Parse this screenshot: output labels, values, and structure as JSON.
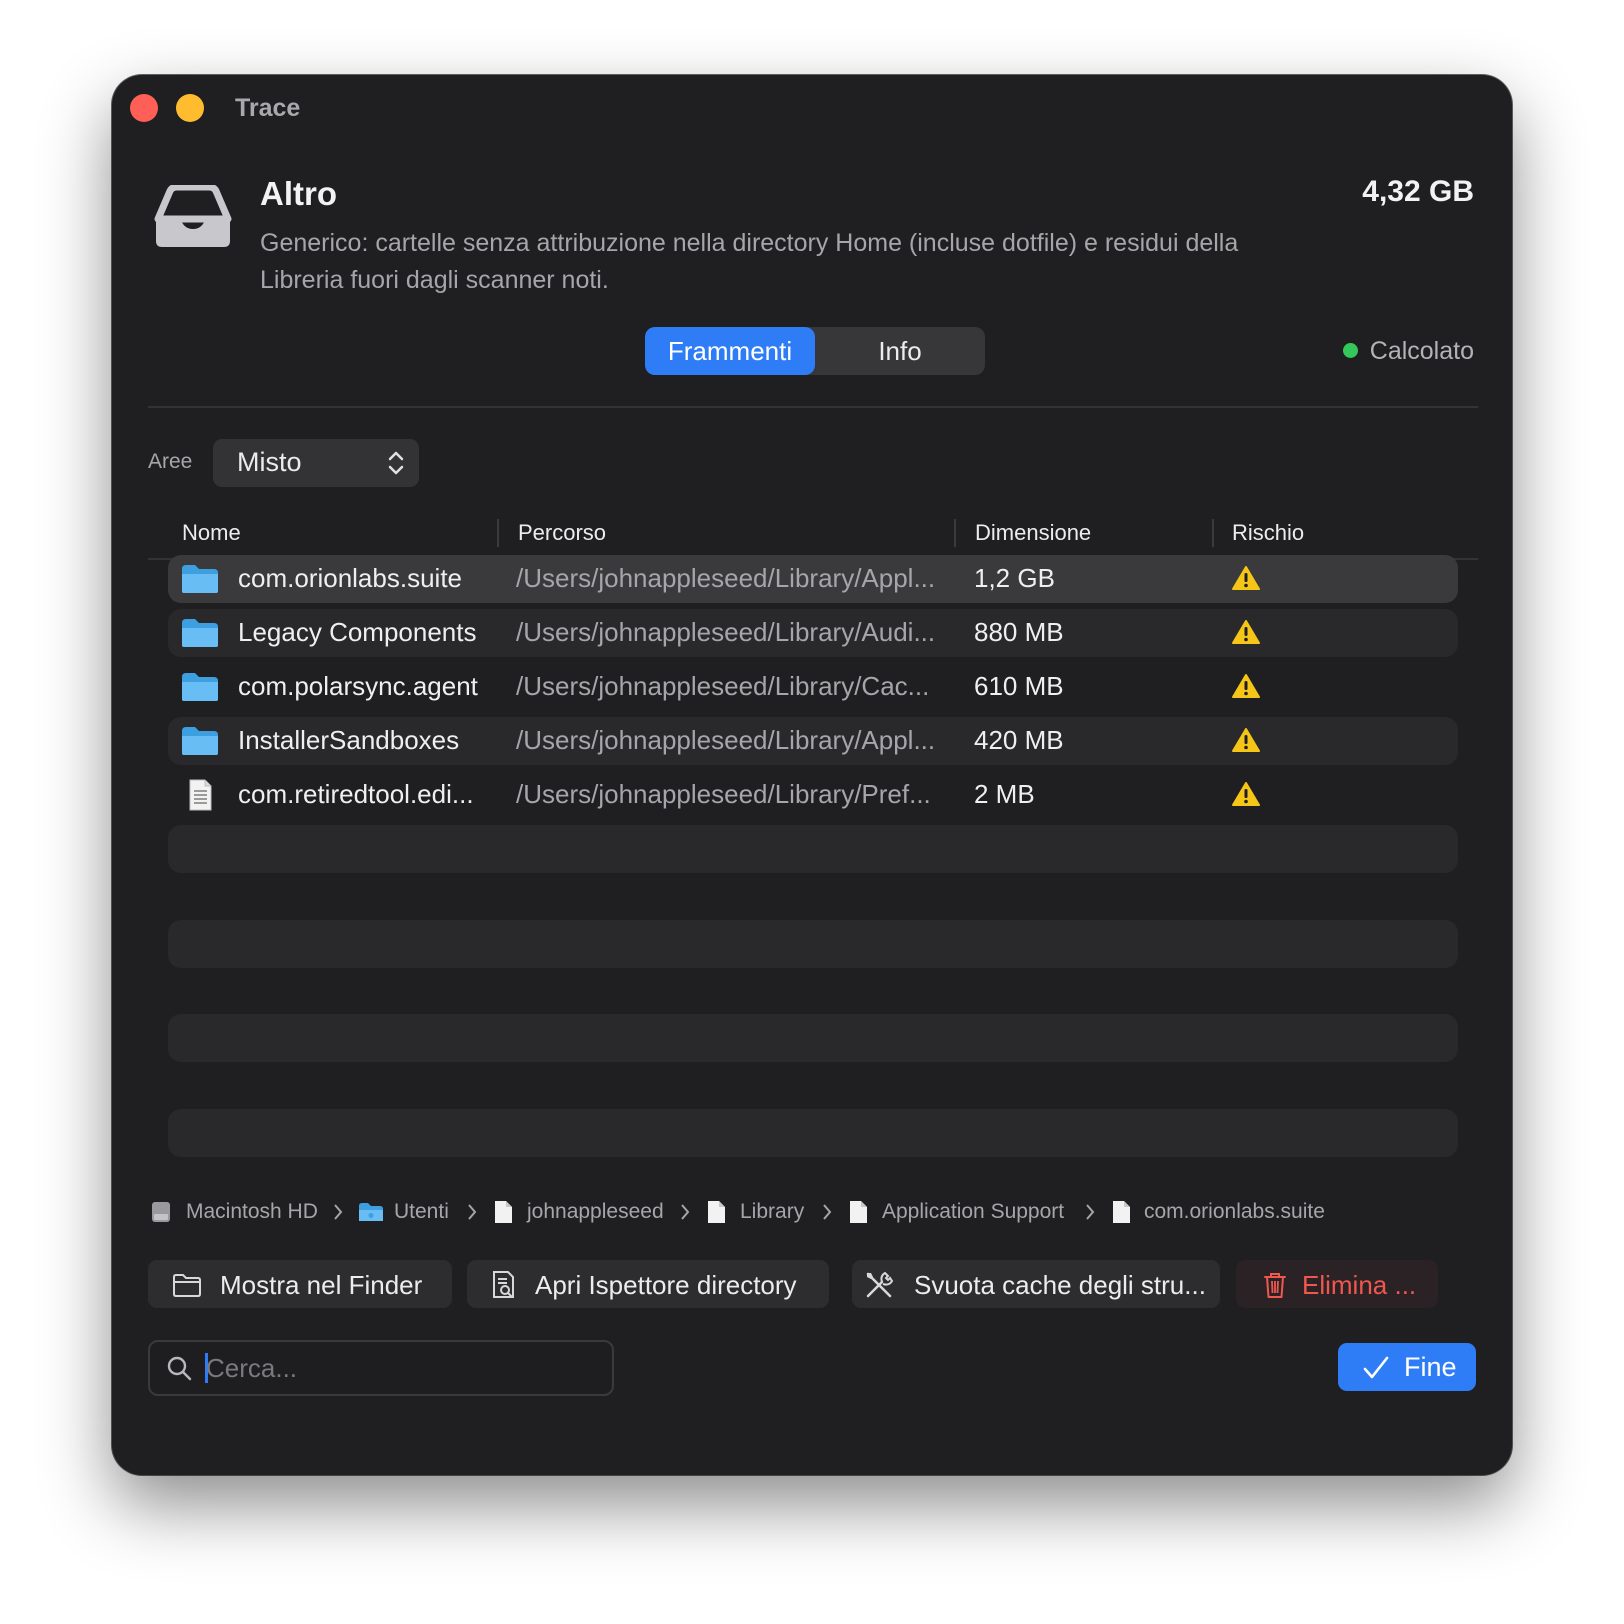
{
  "window": {
    "title": "Trace"
  },
  "category": {
    "icon": "tray-icon",
    "title": "Altro",
    "description": "Generico: cartelle senza attribuzione nella directory Home (incluse dotfile) e residui della Libreria fuori dagli scanner noti.",
    "total_size": "4,32 GB"
  },
  "tabs": [
    {
      "label": "Frammenti",
      "active": true
    },
    {
      "label": "Info",
      "active": false
    }
  ],
  "status": {
    "label": "Calcolato",
    "color": "#34c759"
  },
  "filter": {
    "label": "Aree",
    "value": "Misto"
  },
  "table": {
    "columns": [
      "Nome",
      "Percorso",
      "Dimensione",
      "Rischio"
    ],
    "rows": [
      {
        "icon": "folder-icon",
        "name": "com.orionlabs.suite",
        "path": "/Users/johnappleseed/Library/Appl...",
        "size": "1,2 GB",
        "risk": "warning-icon"
      },
      {
        "icon": "folder-icon",
        "name": "Legacy Components",
        "path": "/Users/johnappleseed/Library/Audi...",
        "size": "880 MB",
        "risk": "warning-icon"
      },
      {
        "icon": "folder-icon",
        "name": "com.polarsync.agent",
        "path": "/Users/johnappleseed/Library/Cac...",
        "size": "610 MB",
        "risk": "warning-icon"
      },
      {
        "icon": "folder-icon",
        "name": "InstallerSandboxes",
        "path": "/Users/johnappleseed/Library/Appl...",
        "size": "420 MB",
        "risk": "warning-icon"
      },
      {
        "icon": "document-icon",
        "name": "com.retiredtool.edi...",
        "path": "/Users/johnappleseed/Library/Pref...",
        "size": "2 MB",
        "risk": "warning-icon"
      }
    ]
  },
  "breadcrumb": [
    "Macintosh HD",
    "Utenti",
    "johnappleseed",
    "Library",
    "Application Support",
    "com.orionlabs.suite"
  ],
  "actions": {
    "show_finder": "Mostra nel Finder",
    "inspector": "Apri Ispettore directory",
    "clear_cache": "Svuota cache degli stru...",
    "delete": "Elimina ..."
  },
  "search": {
    "placeholder": "Cerca..."
  },
  "done": {
    "label": "Fine"
  },
  "colors": {
    "accent": "#2f7df6",
    "danger": "#f0574f",
    "warning": "#f5c518",
    "background": "#1f1f21"
  }
}
